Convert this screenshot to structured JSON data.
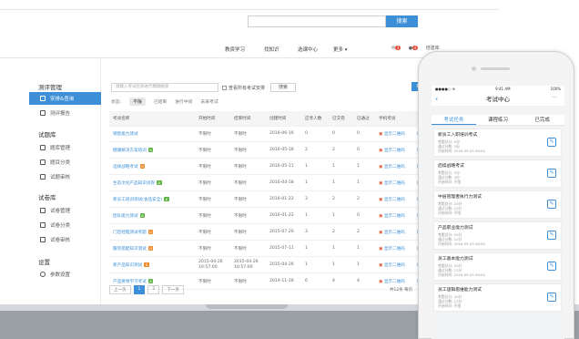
{
  "header": {
    "search_button": "搜索",
    "nav": [
      "教资学习",
      "找知识",
      "选课中心",
      "更多"
    ],
    "more_arrow": "▾",
    "badges": [
      "3",
      "4"
    ],
    "user": "培建库"
  },
  "sidebar": {
    "groups": [
      {
        "title": "测评管理",
        "items": [
          {
            "label": "安排&查询",
            "active": true
          },
          {
            "label": "测评报告",
            "active": false
          }
        ]
      },
      {
        "title": "试题库",
        "items": [
          {
            "label": "题库管理"
          },
          {
            "label": "题目分类"
          },
          {
            "label": "试题审核"
          }
        ]
      },
      {
        "title": "试卷库",
        "items": [
          {
            "label": "试卷管理"
          },
          {
            "label": "试卷分类"
          },
          {
            "label": "试卷审核"
          }
        ]
      },
      {
        "title": "设置",
        "items": [
          {
            "label": "参数设置"
          }
        ]
      }
    ]
  },
  "filter": {
    "placeholder": "请输入考试名称进行模糊搜索",
    "checkbox_label": "查看所有考试安排",
    "search_button": "搜索",
    "status_label": "状态:",
    "statuses": [
      "不限",
      "已结束",
      "进行中间",
      "未来考试"
    ],
    "corner": "E"
  },
  "table": {
    "headers": [
      "考试名称",
      "开始时间",
      "结束时间",
      "创建时间",
      "应考人数",
      "已交卷",
      "已通过",
      "手机考试"
    ],
    "rows": [
      {
        "name": "销售能力测试",
        "tag": "",
        "start": "不限时",
        "end": "不限时",
        "created": "2016-06-16",
        "n1": "0",
        "n2": "0",
        "n3": "0",
        "qr": "显示二维码",
        "op": "编辑"
      },
      {
        "name": "健康解决方案培训",
        "tag": "A",
        "start": "不限时",
        "end": "不限时",
        "created": "2016-05-18",
        "n1": "2",
        "n2": "2",
        "n3": "0",
        "qr": "显示二维码",
        "op": "编辑"
      },
      {
        "name": "选择战略考试",
        "tag": "B",
        "start": "不限时",
        "end": "不限时",
        "created": "2016-05-11",
        "n1": "1",
        "n2": "1",
        "n3": "1",
        "qr": "显示二维码",
        "op": "编辑"
      },
      {
        "name": "生态文化产品知识试卷",
        "tag": "A",
        "start": "不限时",
        "end": "不限时",
        "created": "2016-04-18",
        "n1": "1",
        "n2": "1",
        "n3": "1",
        "qr": "显示二维码",
        "op": "编辑"
      },
      {
        "name": "新员工培训测试(食品安全)",
        "tag": "A",
        "start": "不限时",
        "end": "不限时",
        "created": "2016-01-22",
        "n1": "3",
        "n2": "2",
        "n3": "2",
        "qr": "显示二维码",
        "op": "编辑"
      },
      {
        "name": "团队能力测试",
        "tag": "A",
        "start": "不限时",
        "end": "不限时",
        "created": "2016-01-22",
        "n1": "1",
        "n2": "1",
        "n3": "0",
        "qr": "显示二维码",
        "op": "编辑"
      },
      {
        "name": "门店经理测试考题",
        "tag": "B",
        "start": "不限时",
        "end": "不限时",
        "created": "2015-07-20",
        "n1": "3",
        "n2": "2",
        "n3": "2",
        "qr": "显示二维码",
        "op": "编辑"
      },
      {
        "name": "服装搭配知识测试",
        "tag": "B",
        "start": "不限时",
        "end": "不限时",
        "created": "2015-07-11",
        "n1": "1",
        "n2": "1",
        "n3": "1",
        "qr": "显示二维码",
        "op": "编辑"
      },
      {
        "name": "新产品知识测试",
        "tag": "B",
        "start": "2015-04-26 10:57:00",
        "end": "2015-04-26 10:57:00",
        "created": "2015-04-26",
        "n1": "1",
        "n2": "1",
        "n3": "1",
        "qr": "显示二维码",
        "op": "编辑"
      },
      {
        "name": "产品要领学习考试",
        "tag": "A",
        "start": "不限时",
        "end": "不限时",
        "created": "2014-11-18",
        "n1": "6",
        "n2": "4",
        "n3": "4",
        "qr": "显示二维码",
        "op": "编辑"
      }
    ]
  },
  "pager": {
    "prev": "上一页",
    "pages": [
      "1",
      "2"
    ],
    "next": "下一页",
    "total": "共12条 每页"
  },
  "phone": {
    "status_left": "●●●●○ ≋",
    "time": "9:41 AM",
    "battery": "100%",
    "title": "考试中心",
    "back": "‹",
    "more": "···",
    "tabs": [
      "考试任务",
      "课程练习",
      "已完成"
    ],
    "cards": [
      {
        "title": "新员工入职培训考试",
        "lines": [
          "考题总分: 5分",
          "通过分数: 3分",
          "开始时间: 2016-05-05 09:00"
        ]
      },
      {
        "title": "后续战略考试",
        "lines": [
          "考题总分: 5分",
          "通过分数: 3分",
          "开始时间: 不限"
        ]
      },
      {
        "title": "中层管理者执行力测试",
        "lines": [
          "考题总分: 20分",
          "通过分数: 12分",
          "开始时间: 不限"
        ]
      },
      {
        "title": "产品职业能力测试",
        "lines": [
          "考题总分: 20分",
          "通过分数: 12分",
          "开始时间: 2016-05-05 08:00"
        ]
      },
      {
        "title": "员工基本能力测试",
        "lines": [
          "考题总分: 20分",
          "通过分数: 12分",
          "开始时间: 2016-05-05 09:00"
        ]
      },
      {
        "title": "员工逻辑思维能力测试",
        "lines": [
          "考题总分: 20分",
          "通过分数: 12分",
          "开始时间: 不限"
        ]
      }
    ]
  }
}
